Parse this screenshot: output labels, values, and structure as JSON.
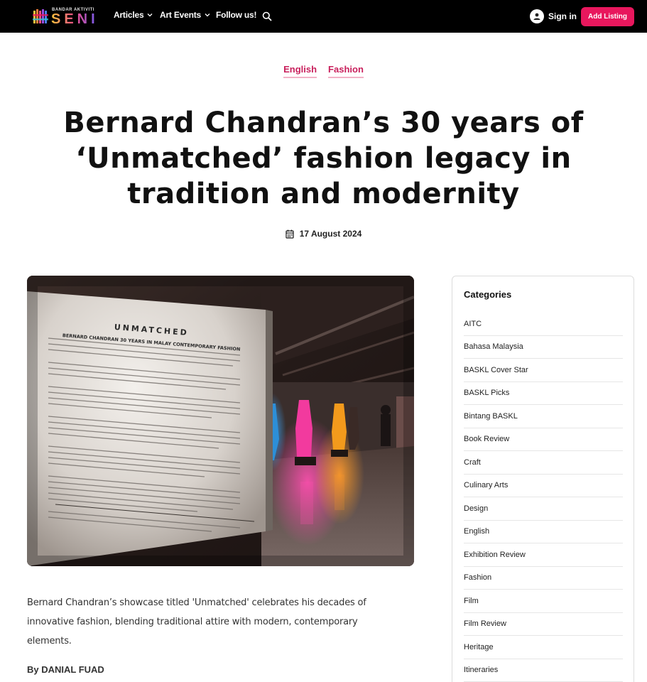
{
  "nav": {
    "logo_small": "BANDAR AKTIVITI",
    "logo_main": "SENI",
    "items": [
      {
        "label": "Articles",
        "has_dropdown": true
      },
      {
        "label": "Art Events",
        "has_dropdown": true
      },
      {
        "label": "Follow us!",
        "has_dropdown": false
      }
    ],
    "search_icon": "search-icon",
    "signin_label": "Sign in",
    "add_listing_label": "Add Listing",
    "accent_color": "#e8175d"
  },
  "article": {
    "tags": [
      "English",
      "Fashion"
    ],
    "title": "Bernard Chandran’s 30 years of ‘Unmatched’ fashion legacy in tradition and modernity",
    "date": "17 August 2024",
    "lead": "Bernard Chandran’s showcase titled 'Unmatched' celebrates his decades of innovative fashion, blending traditional attire with modern, contemporary elements.",
    "byline": "By DANIAL FUAD",
    "image": {
      "heading": "UNMATCHED",
      "subheading": "BERNARD CHANDRAN 30 YEARS IN MALAY CONTEMPORARY FASHION"
    }
  },
  "sidebar": {
    "heading": "Categories",
    "categories": [
      "AITC",
      "Bahasa Malaysia",
      "BASKL Cover Star",
      "BASKL Picks",
      "Bintang BASKL",
      "Book Review",
      "Craft",
      "Culinary Arts",
      "Design",
      "English",
      "Exhibition Review",
      "Fashion",
      "Film",
      "Film Review",
      "Heritage",
      "Itineraries"
    ]
  }
}
